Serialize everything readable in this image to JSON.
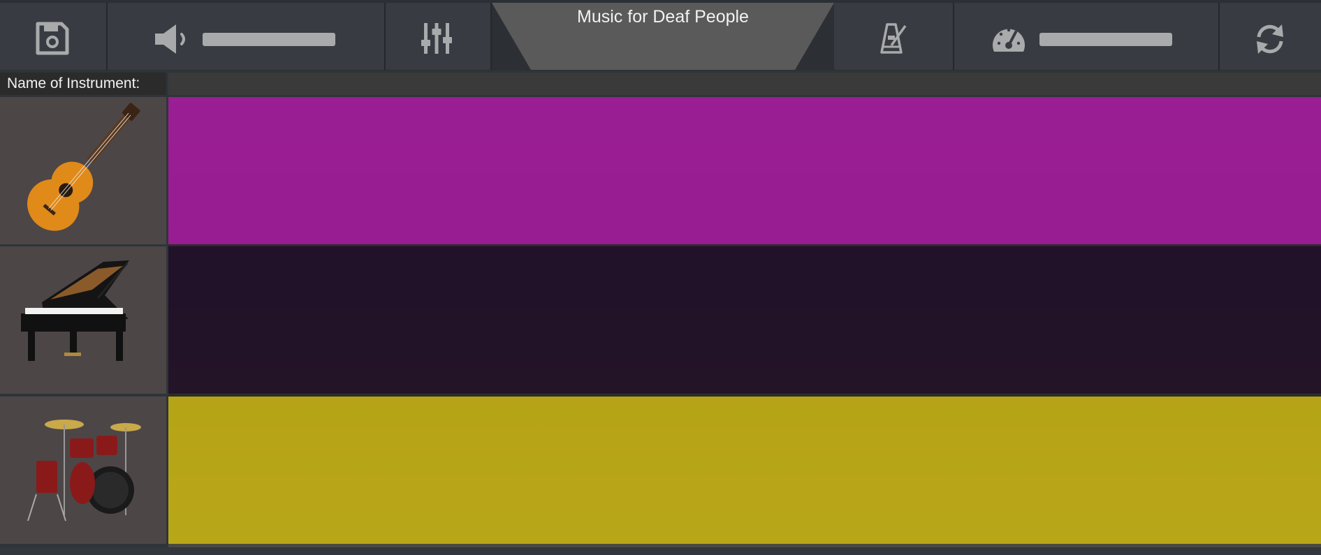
{
  "toolbar": {
    "title": "Music for Deaf People",
    "buttons": [
      {
        "name": "save",
        "icon": "floppy-disk-icon"
      },
      {
        "name": "volume",
        "icon": "speaker-icon"
      },
      {
        "name": "mixer",
        "icon": "equalizer-sliders-icon"
      },
      {
        "name": "metronome",
        "icon": "metronome-icon"
      },
      {
        "name": "tempo",
        "icon": "speedometer-icon"
      },
      {
        "name": "reset",
        "icon": "refresh-icon"
      }
    ]
  },
  "header": {
    "instrument_label": "Name of Instrument:"
  },
  "tracks": [
    {
      "instrument": "guitar",
      "color": "#b01aa6"
    },
    {
      "instrument": "piano",
      "color": "#1f0c26"
    },
    {
      "instrument": "drums",
      "color": "#cdb713"
    }
  ],
  "colors": {
    "toolbar_bg": "#383c42",
    "icon": "#a9aaab",
    "title_bg": "#5a5a5a"
  }
}
